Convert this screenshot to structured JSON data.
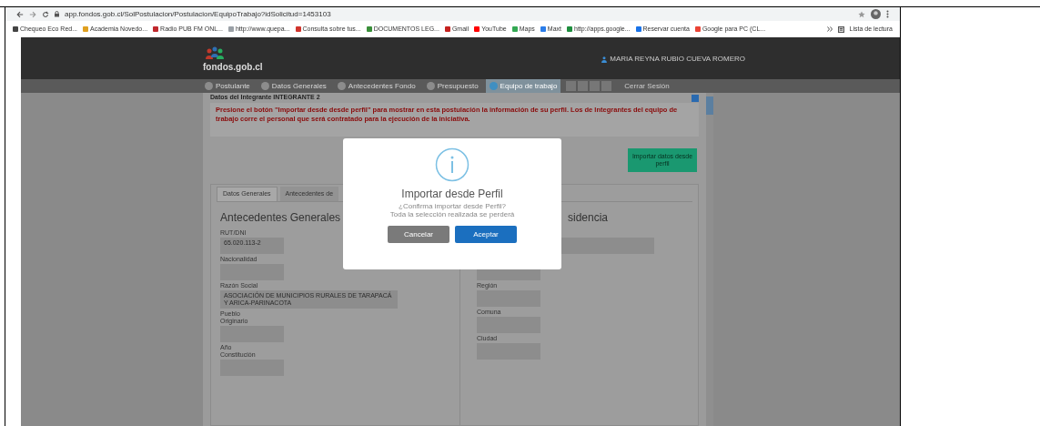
{
  "browser": {
    "url": "app.fondos.gob.cl/SolPostulacion/Postulacion/EquipoTrabajo?idSolicitud=1453103",
    "bookmarks": [
      {
        "label": "Chequeo Eco Red...",
        "color": "#444444"
      },
      {
        "label": "Academia Novedo...",
        "color": "#e0a020"
      },
      {
        "label": "Radio PUB FM ONL...",
        "color": "#c0282d"
      },
      {
        "label": "http://www.quepa...",
        "color": "#9aa0a6"
      },
      {
        "label": "Consulta sobre tus...",
        "color": "#d0342c"
      },
      {
        "label": "DOCUMENTOS LEG...",
        "color": "#3a8f3a"
      },
      {
        "label": "Gmail",
        "color": "#c5221f"
      },
      {
        "label": "YouTube",
        "color": "#ff0000"
      },
      {
        "label": "Maps",
        "color": "#34a853"
      },
      {
        "label": "Maxt",
        "color": "#2b7de9"
      },
      {
        "label": "http://apps.google...",
        "color": "#1e8e3e"
      },
      {
        "label": "Reservar cuenta",
        "color": "#1a73e8"
      },
      {
        "label": "Google para PC (CL...",
        "color": "#ea4335"
      }
    ],
    "reading_list": "Lista de lectura"
  },
  "site": {
    "logo": "fondos.gob.cl",
    "user": "MARIA REYNA RUBIO CUEVA ROMERO",
    "steps": [
      {
        "label": "Postulante",
        "selected": false
      },
      {
        "label": "Datos Generales",
        "selected": false
      },
      {
        "label": "Antecedentes Fondo",
        "selected": false
      },
      {
        "label": "Presupuesto",
        "selected": false
      },
      {
        "label": "Equipo de trabajo",
        "selected": true
      }
    ],
    "logout": "Cerrar Sesión"
  },
  "panel": {
    "title": "Datos del Integrante INTEGRANTE 2",
    "alert": "Presione el botón \"Importar desde desde perfil\" para mostrar en esta postulación la información de su perfil. Los de Integrantes del equipo de trabajo corre el personal que será contratado para la ejecución de la iniciativa.",
    "import_button": "Importar datos desde perfil",
    "tabs": [
      {
        "label": "Datos Generales",
        "selected": true
      },
      {
        "label": "Antecedentes de",
        "selected": false
      }
    ],
    "left": {
      "heading": "Antecedentes Generales",
      "fields": [
        {
          "kind": "short",
          "label": "RUT/DNI",
          "value": "65.020.113-2"
        },
        {
          "kind": "short",
          "label": "Nacionalidad"
        },
        {
          "kind": "wide",
          "label": "Razón Social",
          "value": "ASOCIACIÓN DE MUNICIPIOS RURALES DE TARAPACÁ Y ARICA-PARINACOTA"
        },
        {
          "kind": "short",
          "label": "Pueblo Originario"
        },
        {
          "kind": "short",
          "label": "Año Constitución"
        }
      ]
    },
    "right": {
      "heading": "sidencia",
      "fields": [
        {
          "kind": "wide"
        },
        {
          "kind": "short"
        },
        {
          "kind": "short",
          "label": "Región"
        },
        {
          "kind": "short",
          "label": "Comuna"
        },
        {
          "kind": "short",
          "label": "Ciudad"
        }
      ]
    }
  },
  "dialog": {
    "title": "Importar desde Perfil",
    "message": [
      "¿Confirma importar desde Perfil?",
      "Toda la selección realizada se perderá"
    ],
    "buttons": [
      {
        "label": "Cancelar",
        "kind": "secondary"
      },
      {
        "label": "Aceptar",
        "kind": "primary"
      }
    ]
  }
}
